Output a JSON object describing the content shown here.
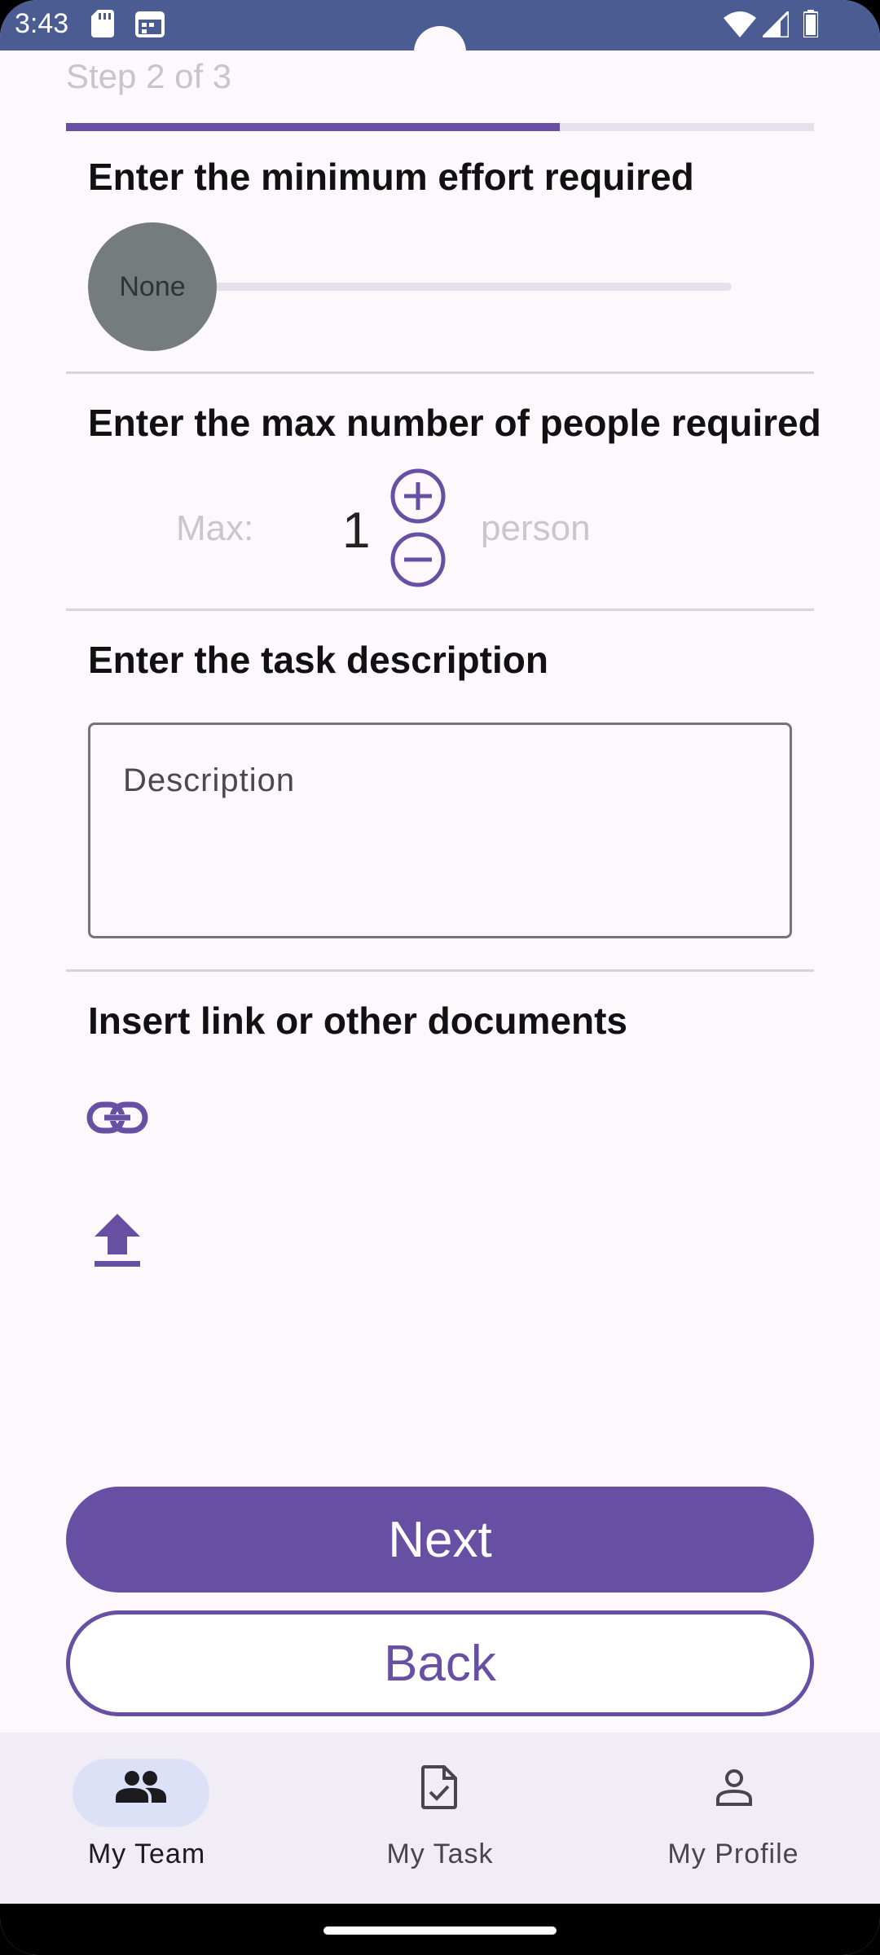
{
  "status_bar": {
    "time": "3:43",
    "icons": [
      "sd-card-icon",
      "calendar-icon",
      "wifi-icon",
      "signal-icon",
      "battery-icon"
    ]
  },
  "wizard": {
    "step_label": "Step 2 of 3",
    "progress": 0.66
  },
  "effort": {
    "title": "Enter the minimum effort required",
    "value_label": "None",
    "value": 0
  },
  "people": {
    "title": "Enter the max number of people required",
    "max_label": "Max:",
    "value": "1",
    "unit": "person",
    "increment_icon": "plus-circle-icon",
    "decrement_icon": "minus-circle-icon"
  },
  "description": {
    "title": "Enter the task description",
    "placeholder": "Description",
    "value": ""
  },
  "attachments": {
    "title": "Insert link or other documents",
    "link_icon": "link-icon",
    "upload_icon": "upload-icon"
  },
  "actions": {
    "next_label": "Next",
    "back_label": "Back"
  },
  "bottom_nav": {
    "items": [
      {
        "label": "My Team",
        "icon": "people-icon",
        "active": true
      },
      {
        "label": "My Task",
        "icon": "task-icon",
        "active": false
      },
      {
        "label": "My Profile",
        "icon": "person-icon",
        "active": false
      }
    ]
  },
  "colors": {
    "primary": "#6750A4",
    "status_bar": "#4B5C93",
    "background": "#FCF8FC",
    "nav_background": "#F0EDF6",
    "nav_active_pill": "#DDE1F8"
  }
}
